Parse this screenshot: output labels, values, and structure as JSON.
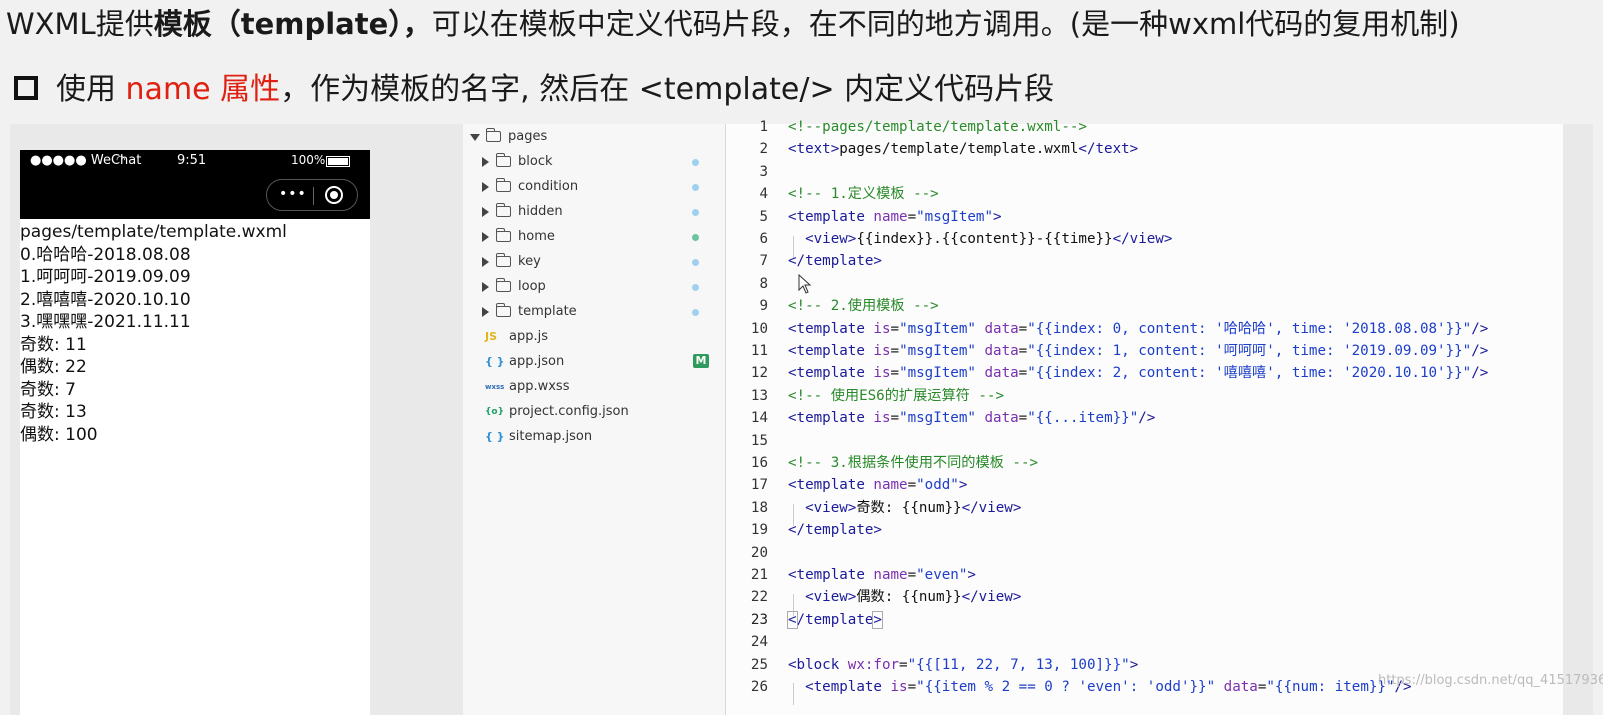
{
  "slide": {
    "title_prefix": "WXML提供",
    "title_bold": "模板（template），",
    "title_suffix": "可以在模板中定义代码片段，在不同的地方调用。(是一种wxml代码的复用机制)",
    "subtitle_prefix": "使用 ",
    "subtitle_highlight": "name 属性",
    "subtitle_suffix": "，作为模板的名字, 然后在 <template/> 内定义代码片段"
  },
  "phone": {
    "carrier": "●●●●● WeChat",
    "time": "9:51",
    "battery": "100%",
    "capsule_more": "•••",
    "lines": [
      "pages/template/template.wxml",
      "0.哈哈哈-2018.08.08",
      "1.呵呵呵-2019.09.09",
      "2.嘻嘻嘻-2020.10.10",
      "3.嘿嘿嘿-2021.11.11",
      "奇数: 11",
      "偶数: 22",
      "奇数: 7",
      "奇数: 13",
      "偶数: 100"
    ]
  },
  "explorer": {
    "root": "pages",
    "folders": [
      "block",
      "condition",
      "hidden",
      "home",
      "key",
      "loop",
      "template"
    ],
    "files": [
      {
        "name": "app.js",
        "icon": "JS"
      },
      {
        "name": "app.json",
        "icon": "{ }",
        "badge": "M"
      },
      {
        "name": "app.wxss",
        "icon": "wxss"
      },
      {
        "name": "project.config.json",
        "icon": "{o}"
      },
      {
        "name": "sitemap.json",
        "icon": "{ }"
      }
    ],
    "colors": {
      "dot_blue": "#9ed0ef",
      "dot_green": "#6cc4a1",
      "badge": "#2e9b5c"
    }
  },
  "editor": {
    "line_numbers": [
      "1",
      "2",
      "3",
      "4",
      "5",
      "6",
      "7",
      "8",
      "9",
      "10",
      "11",
      "12",
      "13",
      "14",
      "15",
      "16",
      "17",
      "18",
      "19",
      "20",
      "21",
      "22",
      "23",
      "24",
      "25",
      "26"
    ],
    "colors": {
      "comment": "#2a8a2a",
      "tag": "#1a1a9a",
      "attr": "#7b2fb0",
      "string": "#1d3ec9"
    }
  },
  "watermark": "https://blog.csdn.net/qq_41517936"
}
